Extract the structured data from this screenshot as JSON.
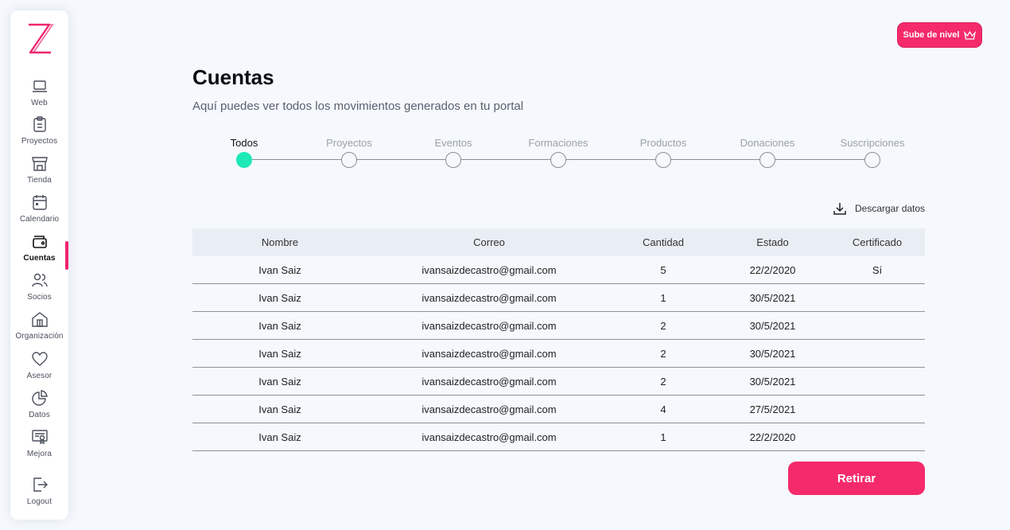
{
  "sidebar": {
    "items": [
      {
        "label": "Web",
        "icon": "laptop-icon"
      },
      {
        "label": "Proyectos",
        "icon": "clipboard-icon"
      },
      {
        "label": "Tienda",
        "icon": "store-icon"
      },
      {
        "label": "Calendario",
        "icon": "calendar-icon"
      },
      {
        "label": "Cuentas",
        "icon": "wallet-icon"
      },
      {
        "label": "Socios",
        "icon": "users-icon"
      },
      {
        "label": "Organización",
        "icon": "building-icon"
      },
      {
        "label": "Asesor",
        "icon": "heart-icon"
      },
      {
        "label": "Datos",
        "icon": "pie-chart-icon"
      },
      {
        "label": "Mejora",
        "icon": "certificate-icon"
      },
      {
        "label": "Logout",
        "icon": "logout-icon"
      }
    ],
    "active_index": 4
  },
  "header": {
    "upgrade_label": "Sube de nivel",
    "title": "Cuentas",
    "subtitle": "Aquí puedes ver todos los movimientos generados en tu portal"
  },
  "steps": [
    {
      "label": "Todos",
      "active": true
    },
    {
      "label": "Proyectos",
      "active": false
    },
    {
      "label": "Eventos",
      "active": false
    },
    {
      "label": "Formaciones",
      "active": false
    },
    {
      "label": "Productos",
      "active": false
    },
    {
      "label": "Donaciones",
      "active": false
    },
    {
      "label": "Suscripciones",
      "active": false
    }
  ],
  "download_label": "Descargar datos",
  "table": {
    "columns": [
      "Nombre",
      "Correo",
      "Cantidad",
      "Estado",
      "Certificado"
    ],
    "rows": [
      [
        "Ivan Saiz",
        "ivansaizdecastro@gmail.com",
        "5",
        "22/2/2020",
        "Sí"
      ],
      [
        "Ivan Saiz",
        "ivansaizdecastro@gmail.com",
        "1",
        "30/5/2021",
        ""
      ],
      [
        "Ivan Saiz",
        "ivansaizdecastro@gmail.com",
        "2",
        "30/5/2021",
        ""
      ],
      [
        "Ivan Saiz",
        "ivansaizdecastro@gmail.com",
        "2",
        "30/5/2021",
        ""
      ],
      [
        "Ivan Saiz",
        "ivansaizdecastro@gmail.com",
        "2",
        "30/5/2021",
        ""
      ],
      [
        "Ivan Saiz",
        "ivansaizdecastro@gmail.com",
        "4",
        "27/5/2021",
        ""
      ],
      [
        "Ivan Saiz",
        "ivansaizdecastro@gmail.com",
        "1",
        "22/2/2020",
        ""
      ]
    ]
  },
  "retirar_label": "Retirar",
  "colors": {
    "accent": "#f52a6a",
    "step_active": "#1de9b6",
    "background": "#f5f8fc"
  }
}
